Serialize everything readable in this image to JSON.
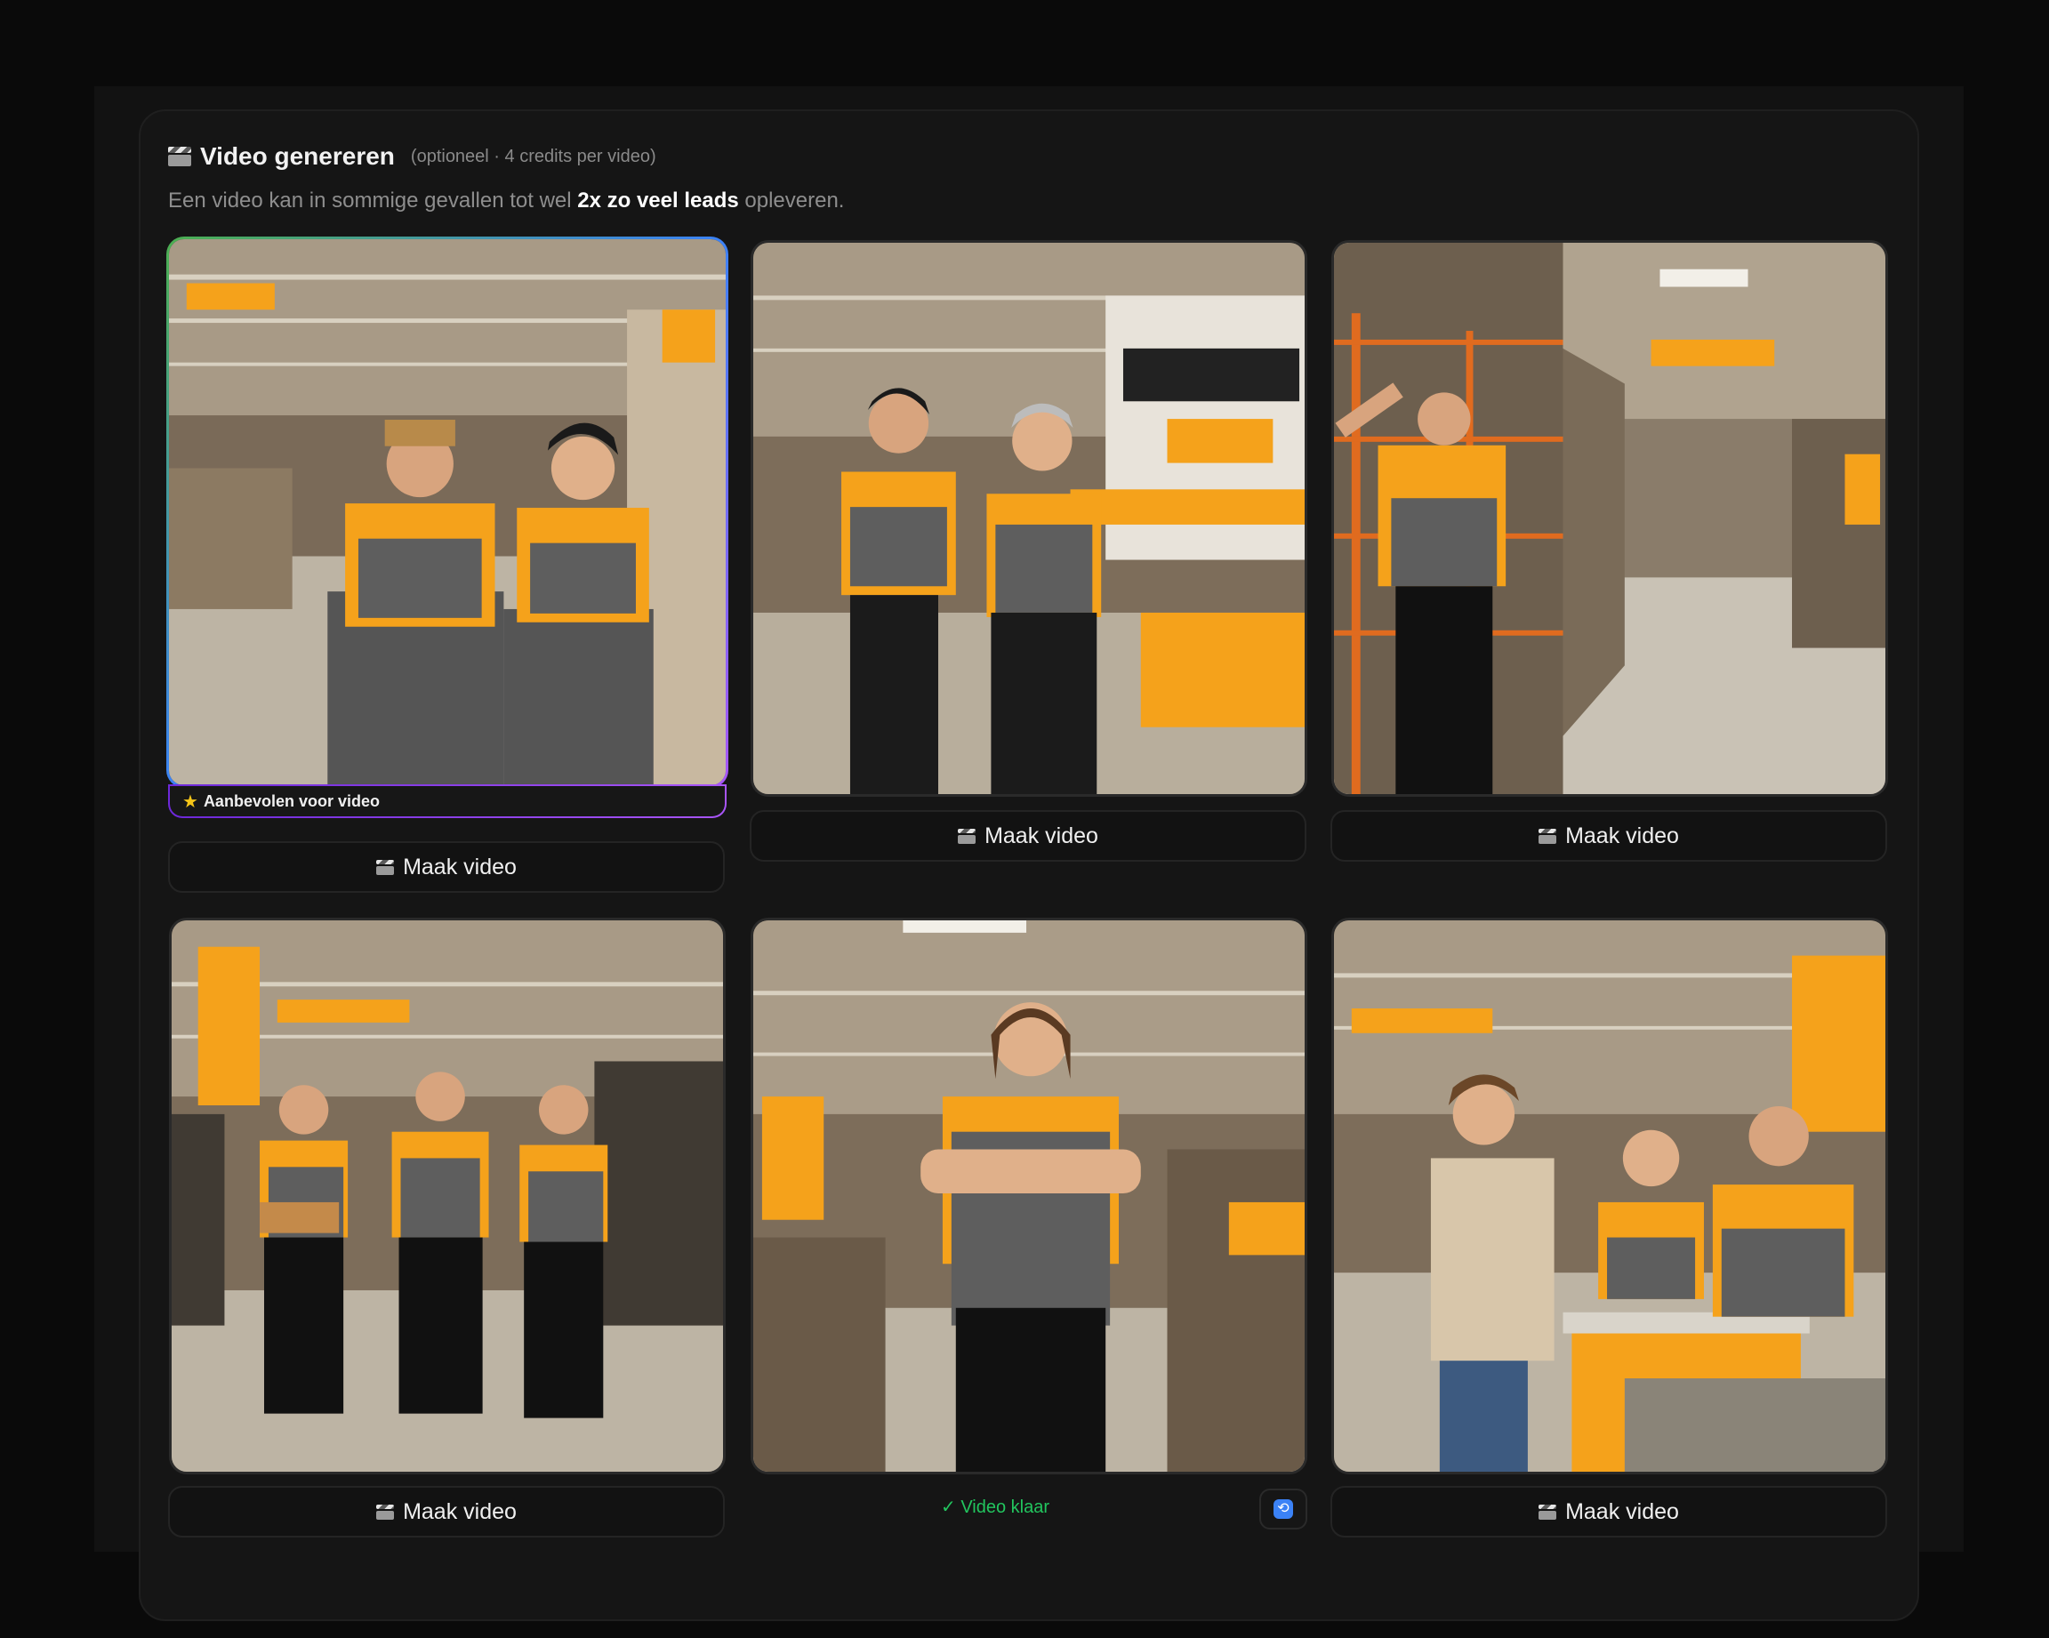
{
  "header": {
    "title": "Video genereren",
    "note": "(optioneel · 4 credits per video)",
    "subtitle_pre": "Een video kan in sommige gevallen tot wel ",
    "subtitle_bold": "2x zo veel leads",
    "subtitle_post": " opleveren."
  },
  "recommended_badge": "Aanbevolen voor video",
  "buttons": {
    "make_video": "Maak video"
  },
  "status": {
    "ready": "✓ Video klaar"
  },
  "icons": {
    "clapper": "clapperboard-icon",
    "star": "star-icon",
    "refresh": "refresh-icon"
  },
  "colors": {
    "accent_green": "#22c55e",
    "recommended_border_start": "#4caf50",
    "recommended_border_end": "#a855f7",
    "store_orange": "#f5a21b"
  },
  "tiles": [
    {
      "description_key": "tile-1",
      "recommended": true,
      "status": "idle"
    },
    {
      "description_key": "tile-2",
      "recommended": false,
      "status": "idle"
    },
    {
      "description_key": "tile-3",
      "recommended": false,
      "status": "idle"
    },
    {
      "description_key": "tile-4",
      "recommended": false,
      "status": "idle"
    },
    {
      "description_key": "tile-5",
      "recommended": false,
      "status": "ready"
    },
    {
      "description_key": "tile-6",
      "recommended": false,
      "status": "idle"
    }
  ]
}
